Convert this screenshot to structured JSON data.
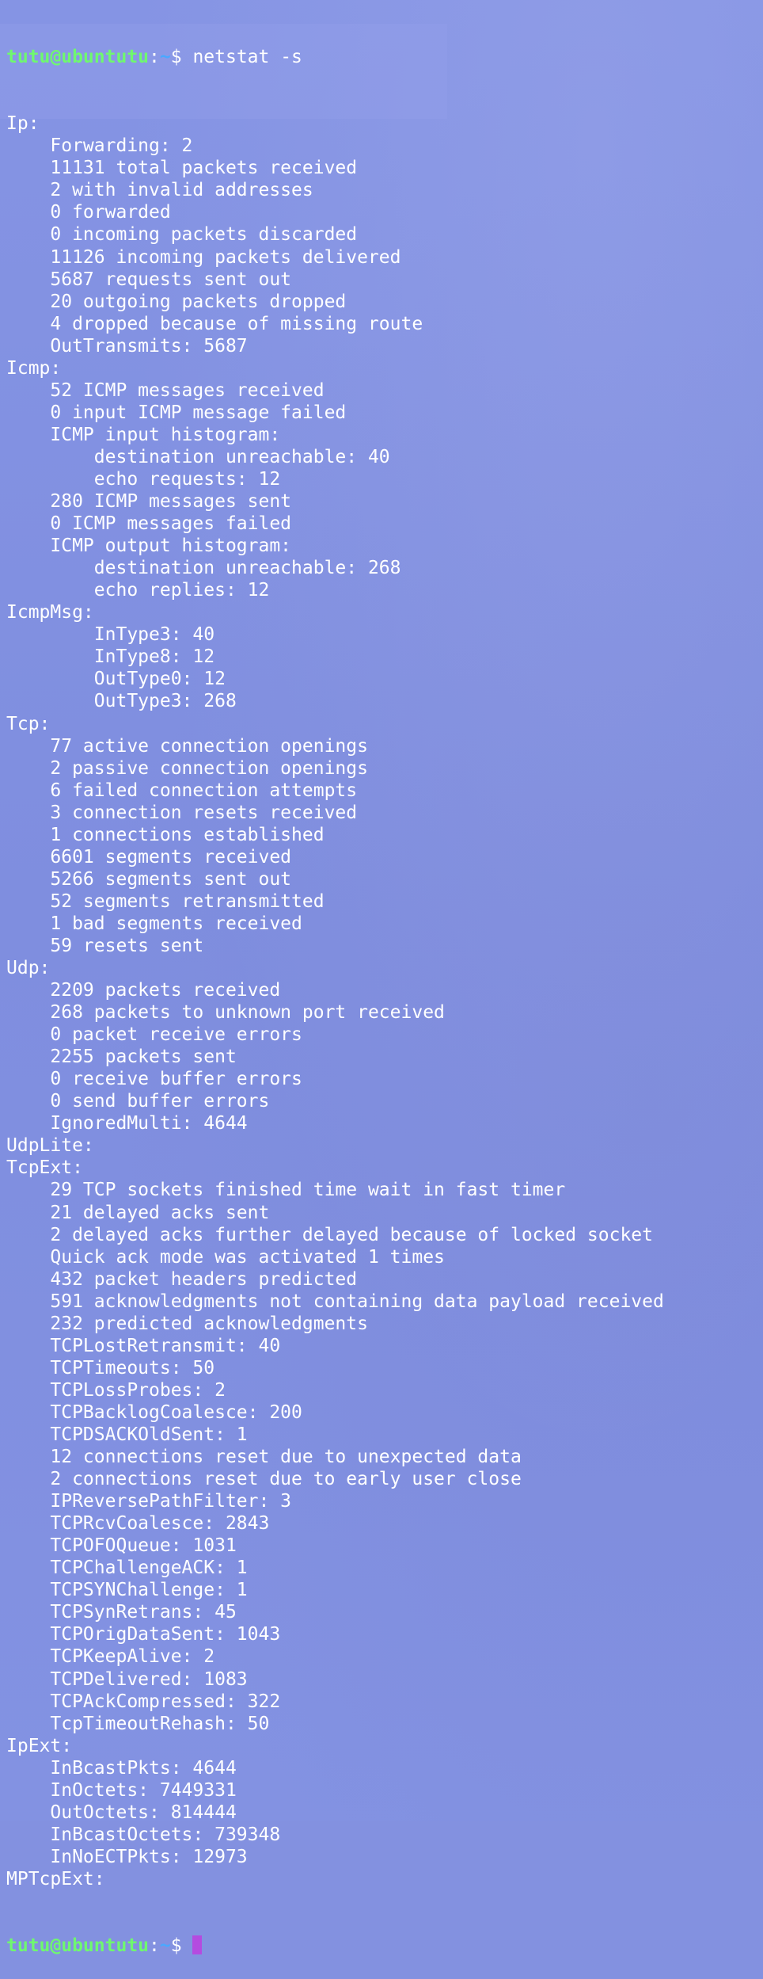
{
  "terminal": {
    "prompt_user": "tutu@ubuntutu",
    "prompt_sep": ":",
    "prompt_path": "~",
    "prompt_symbol": "$ ",
    "command": "netstat -s",
    "cursor_color": "#b44be0"
  },
  "output_lines": [
    "Ip:",
    "    Forwarding: 2",
    "    11131 total packets received",
    "    2 with invalid addresses",
    "    0 forwarded",
    "    0 incoming packets discarded",
    "    11126 incoming packets delivered",
    "    5687 requests sent out",
    "    20 outgoing packets dropped",
    "    4 dropped because of missing route",
    "    OutTransmits: 5687",
    "Icmp:",
    "    52 ICMP messages received",
    "    0 input ICMP message failed",
    "    ICMP input histogram:",
    "        destination unreachable: 40",
    "        echo requests: 12",
    "    280 ICMP messages sent",
    "    0 ICMP messages failed",
    "    ICMP output histogram:",
    "        destination unreachable: 268",
    "        echo replies: 12",
    "IcmpMsg:",
    "        InType3: 40",
    "        InType8: 12",
    "        OutType0: 12",
    "        OutType3: 268",
    "Tcp:",
    "    77 active connection openings",
    "    2 passive connection openings",
    "    6 failed connection attempts",
    "    3 connection resets received",
    "    1 connections established",
    "    6601 segments received",
    "    5266 segments sent out",
    "    52 segments retransmitted",
    "    1 bad segments received",
    "    59 resets sent",
    "Udp:",
    "    2209 packets received",
    "    268 packets to unknown port received",
    "    0 packet receive errors",
    "    2255 packets sent",
    "    0 receive buffer errors",
    "    0 send buffer errors",
    "    IgnoredMulti: 4644",
    "UdpLite:",
    "TcpExt:",
    "    29 TCP sockets finished time wait in fast timer",
    "    21 delayed acks sent",
    "    2 delayed acks further delayed because of locked socket",
    "    Quick ack mode was activated 1 times",
    "    432 packet headers predicted",
    "    591 acknowledgments not containing data payload received",
    "    232 predicted acknowledgments",
    "    TCPLostRetransmit: 40",
    "    TCPTimeouts: 50",
    "    TCPLossProbes: 2",
    "    TCPBacklogCoalesce: 200",
    "    TCPDSACKOldSent: 1",
    "    12 connections reset due to unexpected data",
    "    2 connections reset due to early user close",
    "    IPReversePathFilter: 3",
    "    TCPRcvCoalesce: 2843",
    "    TCPOFOQueue: 1031",
    "    TCPChallengeACK: 1",
    "    TCPSYNChallenge: 1",
    "    TCPSynRetrans: 45",
    "    TCPOrigDataSent: 1043",
    "    TCPKeepAlive: 2",
    "    TCPDelivered: 1083",
    "    TCPAckCompressed: 322",
    "    TcpTimeoutRehash: 50",
    "IpExt:",
    "    InBcastPkts: 4644",
    "    InOctets: 7449331",
    "    OutOctets: 814444",
    "    InBcastOctets: 739348",
    "    InNoECTPkts: 12973",
    "MPTcpExt:"
  ]
}
